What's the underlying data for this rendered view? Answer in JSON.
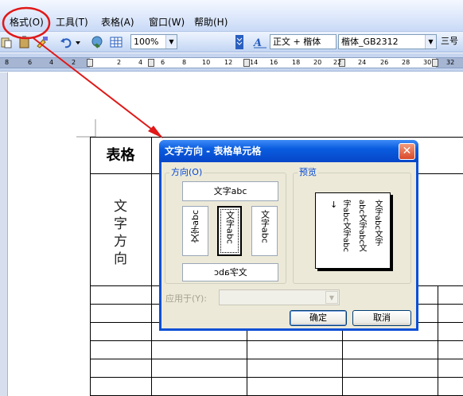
{
  "menu": {
    "items": [
      {
        "label": "格式(O)"
      },
      {
        "label": "工具(T)"
      },
      {
        "label": "表格(A)"
      },
      {
        "label": "窗口(W)"
      },
      {
        "label": "帮助(H)"
      }
    ]
  },
  "toolbar": {
    "zoom": "100%",
    "style": "正文 + 楷体",
    "font": "楷体_GB2312",
    "size": "三号"
  },
  "ruler": {
    "ticks": [
      "8",
      "6",
      "4",
      "2",
      "2",
      "4",
      "6",
      "8",
      "10",
      "12",
      "14",
      "16",
      "18",
      "20",
      "22",
      "24",
      "26",
      "28",
      "30",
      "32"
    ]
  },
  "document": {
    "table_header": "表格",
    "vertical_cell": [
      "文",
      "字",
      "方",
      "向"
    ]
  },
  "dialog": {
    "title": "文字方向 - 表格单元格",
    "close_symbol": "✕",
    "orientation_group": "方向(O)",
    "options": {
      "horizontal": "文字abc",
      "vertical_rotated_left": "文字abc",
      "vertical_stacked": "文字abc",
      "vertical_rotated_right": "文字abc",
      "horizontal_mirrored": "文字abc"
    },
    "preview_group": "预览",
    "preview_columns": [
      "文字abc文字",
      "abc文字abc文",
      "字abc文字abc"
    ],
    "preview_arrow": "↓",
    "apply_label": "应用于(Y):",
    "apply_value": "",
    "ok_button": "确定",
    "cancel_button": "取消"
  },
  "colors": {
    "annotation": "#e01818",
    "title_bar": "#0a5ce0",
    "dialog_face": "#ece9d8"
  }
}
